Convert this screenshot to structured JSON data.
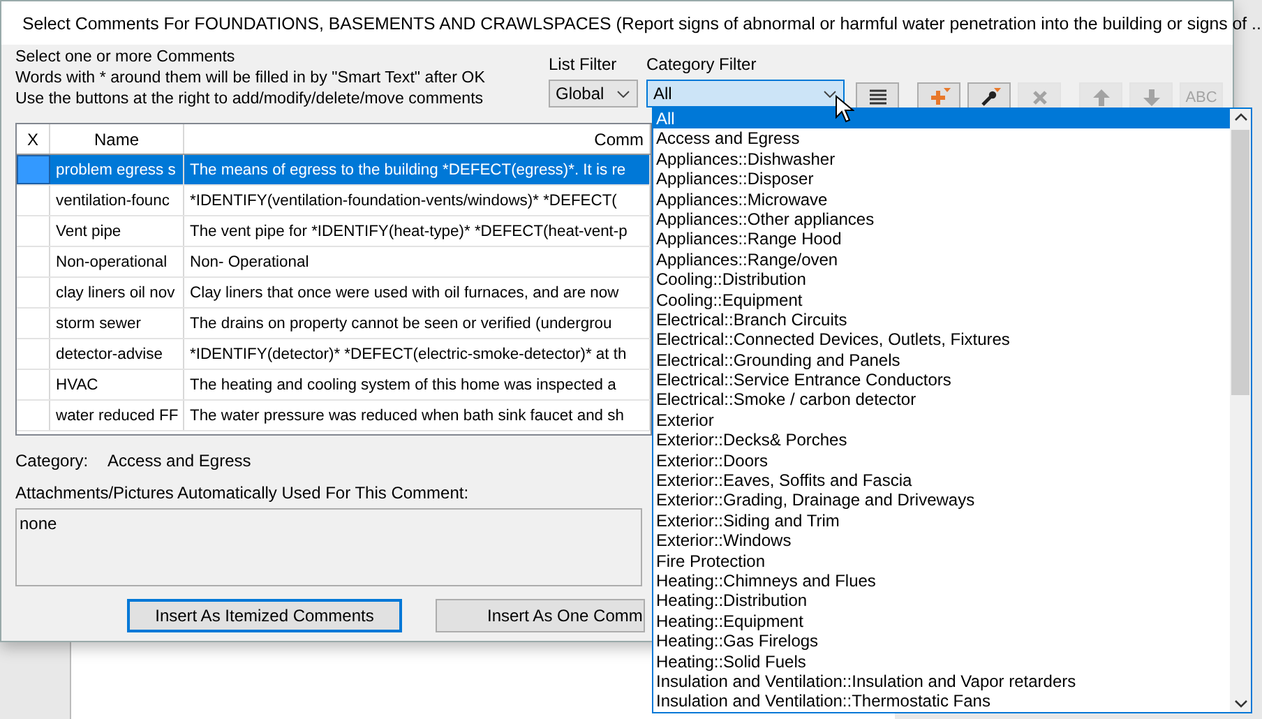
{
  "window": {
    "title": "Select Comments For FOUNDATIONS, BASEMENTS AND CRAWLSPACES (Report signs of abnormal or harmful water penetration into the building or signs of ..."
  },
  "instructions": [
    "Select one or more Comments",
    "Words with * around them will be filled in by \"Smart Text\" after OK",
    "Use the buttons at the right to add/modify/delete/move comments"
  ],
  "list_filter": {
    "label": "List Filter",
    "value": "Global"
  },
  "category_filter": {
    "label": "Category Filter",
    "value": "All",
    "expanded": true,
    "options": [
      {
        "label": "All",
        "selected": true
      },
      {
        "label": "Access and Egress",
        "selected": false
      },
      {
        "label": "Appliances::Dishwasher",
        "selected": false
      },
      {
        "label": "Appliances::Disposer",
        "selected": false
      },
      {
        "label": "Appliances::Microwave",
        "selected": false
      },
      {
        "label": "Appliances::Other appliances",
        "selected": false
      },
      {
        "label": "Appliances::Range Hood",
        "selected": false
      },
      {
        "label": "Appliances::Range/oven",
        "selected": false
      },
      {
        "label": "Cooling::Distribution",
        "selected": false
      },
      {
        "label": "Cooling::Equipment",
        "selected": false
      },
      {
        "label": "Electrical::Branch Circuits",
        "selected": false
      },
      {
        "label": "Electrical::Connected Devices, Outlets, Fixtures",
        "selected": false
      },
      {
        "label": "Electrical::Grounding and Panels",
        "selected": false
      },
      {
        "label": "Electrical::Service Entrance Conductors",
        "selected": false
      },
      {
        "label": "Electrical::Smoke / carbon detector",
        "selected": false
      },
      {
        "label": "Exterior",
        "selected": false
      },
      {
        "label": "Exterior::Decks& Porches",
        "selected": false
      },
      {
        "label": "Exterior::Doors",
        "selected": false
      },
      {
        "label": "Exterior::Eaves, Soffits and Fascia",
        "selected": false
      },
      {
        "label": "Exterior::Grading, Drainage and Driveways",
        "selected": false
      },
      {
        "label": "Exterior::Siding and Trim",
        "selected": false
      },
      {
        "label": "Exterior::Windows",
        "selected": false
      },
      {
        "label": "Fire Protection",
        "selected": false
      },
      {
        "label": "Heating::Chimneys and Flues",
        "selected": false
      },
      {
        "label": "Heating::Distribution",
        "selected": false
      },
      {
        "label": "Heating::Equipment",
        "selected": false
      },
      {
        "label": "Heating::Gas Firelogs",
        "selected": false
      },
      {
        "label": "Heating::Solid Fuels",
        "selected": false
      },
      {
        "label": "Insulation and Ventilation::Insulation and Vapor retarders",
        "selected": false
      },
      {
        "label": "Insulation and Ventilation::Thermostatic Fans",
        "selected": false
      }
    ]
  },
  "toolbar": [
    {
      "kind": "list",
      "disabled": false
    },
    {
      "kind": "add",
      "disabled": false
    },
    {
      "kind": "edit",
      "disabled": false
    },
    {
      "kind": "delete",
      "disabled": true
    },
    {
      "kind": "up",
      "disabled": true
    },
    {
      "kind": "down",
      "disabled": true
    },
    {
      "kind": "text",
      "label": "ABC",
      "disabled": true
    }
  ],
  "table": {
    "columns": [
      "X",
      "Name",
      "Comm"
    ],
    "rows": [
      {
        "selected": true,
        "name": "problem egress s",
        "comment": "The means of egress to the building *DEFECT(egress)*. It is re"
      },
      {
        "selected": false,
        "name": "ventilation-founc",
        "comment": "*IDENTIFY(ventilation-foundation-vents/windows)* *DEFECT("
      },
      {
        "selected": false,
        "name": "Vent pipe",
        "comment": "The vent pipe for *IDENTIFY(heat-type)* *DEFECT(heat-vent-p"
      },
      {
        "selected": false,
        "name": "Non-operational",
        "comment": "Non- Operational"
      },
      {
        "selected": false,
        "name": "clay liners oil nov",
        "comment": "Clay liners that once were used with oil furnaces, and are now"
      },
      {
        "selected": false,
        "name": "storm sewer",
        "comment": "The drains on property cannot be seen or verified (undergrou"
      },
      {
        "selected": false,
        "name": "detector-advise",
        "comment": "*IDENTIFY(detector)* *DEFECT(electric-smoke-detector)* at th"
      },
      {
        "selected": false,
        "name": "HVAC",
        "comment": "The heating and cooling system of this home was inspected a"
      },
      {
        "selected": false,
        "name": "water reduced FF",
        "comment": "The water pressure was reduced when bath sink faucet and sh"
      }
    ]
  },
  "category": {
    "label": "Category:",
    "value": "Access and Egress"
  },
  "attachments": {
    "label": "Attachments/Pictures Automatically Used For This Comment:",
    "value": "none"
  },
  "buttons": [
    {
      "label": "Insert As Itemized Comments",
      "focused": true
    },
    {
      "label": "Insert As One Comm",
      "focused": false
    }
  ]
}
